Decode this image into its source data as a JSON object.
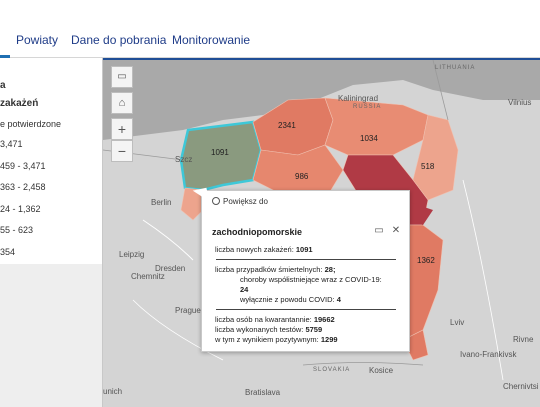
{
  "nav": {
    "tabs": [
      {
        "label": "Powiaty"
      },
      {
        "label": "Dane do pobrania"
      },
      {
        "label": "Monitorowanie"
      }
    ]
  },
  "legend": {
    "heading": "a",
    "subheading": "zakażeń",
    "desc": "e potwierdzone",
    "ranges": [
      "3,471",
      "459 - 3,471",
      "363 - 2,458",
      "24 - 1,362",
      "55 - 623",
      "354"
    ]
  },
  "map": {
    "labels": {
      "kaliningrad": "Kaliningrad",
      "russia": "RUSSIA",
      "lithuania": "LITHUANIA",
      "vilnius": "Vilnius",
      "berlin": "Berlin",
      "leipzig": "Leipzig",
      "dresden": "Dresden",
      "chemnitz": "Chemnitz",
      "prague": "Prague",
      "munich": "unich",
      "bratislava": "Bratislava",
      "slovakia": "SLOVAKIA",
      "kosice": "Kosice",
      "lviv": "Lviv",
      "rivne": "Rivne",
      "ivano": "Ivano-Frankivsk",
      "chernivtsi": "Chernivtsi",
      "szczecin": "Szcz"
    },
    "values": {
      "v1091": "1091",
      "v2341": "2341",
      "v1034": "1034",
      "v518": "518",
      "v986": "986",
      "v1362": "1362"
    },
    "colors": {
      "selected": "#8a9a7f",
      "highlight_border": "#3ec8d8",
      "dark_red": "#b03a45",
      "mid_red": "#e07a63",
      "light_red": "#eda48d",
      "pale_red": "#f2c3b1"
    }
  },
  "popup": {
    "zoom_label": "Powiększ do",
    "title": "zachodniopomorskie",
    "new_cases_label": "liczba nowych zakażeń:",
    "new_cases_value": "1091",
    "deaths_label": "liczba przypadków śmiertelnych:",
    "deaths_value": "28;",
    "comorbid_label": "choroby współistniejące wraz z COVID-19:",
    "comorbid_value": "24",
    "covid_only_label": "wyłącznie z powodu COVID:",
    "covid_only_value": "4",
    "quarantine_label": "liczba osób na kwarantannie:",
    "quarantine_value": "19662",
    "tests_label": "liczba wykonanych testów:",
    "tests_value": "5759",
    "positive_label": "w tym z wynikiem pozytywnym:",
    "positive_value": "1299"
  }
}
